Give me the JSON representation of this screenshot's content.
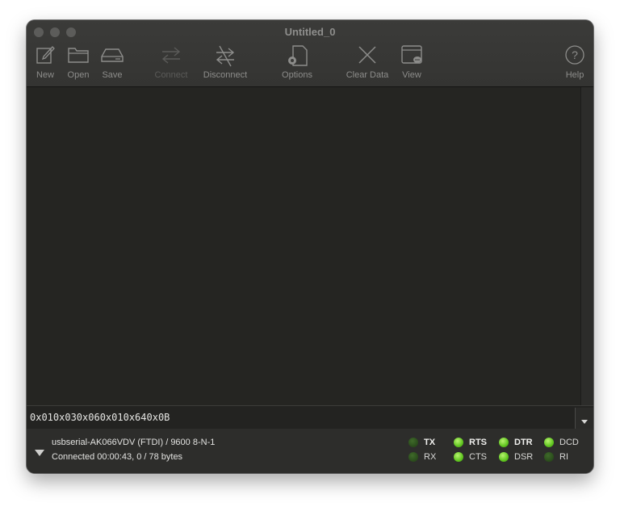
{
  "window": {
    "title": "Untitled_0"
  },
  "toolbar": {
    "new": "New",
    "open": "Open",
    "save": "Save",
    "connect": "Connect",
    "disconnect": "Disconnect",
    "options": "Options",
    "clear_data": "Clear Data",
    "view": "View",
    "help": "Help"
  },
  "input": {
    "value": "0x010x030x060x010x640x0B"
  },
  "status": {
    "port": "usbserial-AK066VDV (FTDI) / 9600 8-N-1",
    "connection": "Connected 00:00:43, 0 / 78 bytes"
  },
  "leds": {
    "tx": {
      "label": "TX",
      "on": false
    },
    "rx": {
      "label": "RX",
      "on": false
    },
    "rts": {
      "label": "RTS",
      "on": true
    },
    "cts": {
      "label": "CTS",
      "on": true
    },
    "dtr": {
      "label": "DTR",
      "on": true
    },
    "dsr": {
      "label": "DSR",
      "on": true
    },
    "dcd": {
      "label": "DCD",
      "on": true
    },
    "ri": {
      "label": "RI",
      "on": false
    }
  }
}
